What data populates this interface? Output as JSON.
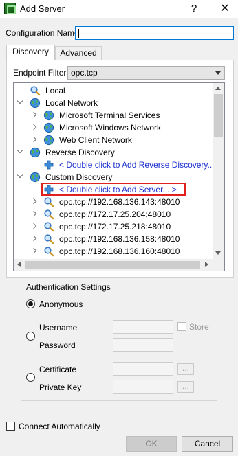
{
  "window": {
    "title": "Add Server",
    "help": "?",
    "close": "✕"
  },
  "config": {
    "label": "Configuration Name",
    "value": ""
  },
  "tabs": [
    {
      "label": "Discovery"
    },
    {
      "label": "Advanced"
    }
  ],
  "endpoint_filter": {
    "label": "Endpoint Filter:",
    "value": "opc.tcp"
  },
  "tree": {
    "local": "Local",
    "local_network": "Local Network",
    "local_network_children": [
      "Microsoft Terminal Services",
      "Microsoft Windows Network",
      "Web Client Network"
    ],
    "reverse_discovery": "Reverse Discovery",
    "reverse_add": "< Double click to Add Reverse Discovery...",
    "custom_discovery": "Custom Discovery",
    "custom_add": "< Double click to Add Server... >",
    "servers": [
      "opc.tcp://192.168.136.143:48010",
      "opc.tcp://172.17.25.204:48010",
      "opc.tcp://172.17.25.218:48010",
      "opc.tcp://192.168.136.158:48010",
      "opc.tcp://192.168.136.160:48010"
    ]
  },
  "auth": {
    "title": "Authentication Settings",
    "anonymous": "Anonymous",
    "username": "Username",
    "password": "Password",
    "store": "Store",
    "certificate": "Certificate",
    "private_key": "Private Key",
    "browse": "..."
  },
  "connect_auto": "Connect Automatically",
  "buttons": {
    "ok": "OK",
    "cancel": "Cancel"
  },
  "colors": {
    "link_blue": "#1a2fd0",
    "highlight_red": "#e0201c",
    "focus_blue": "#0078d7"
  }
}
